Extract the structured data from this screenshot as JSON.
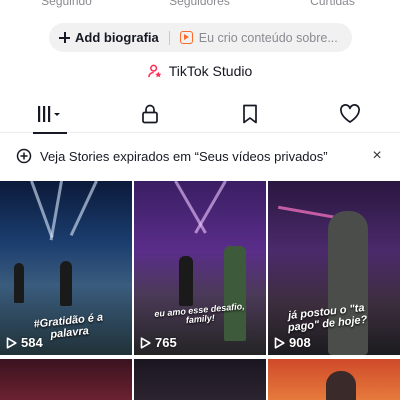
{
  "profile": {
    "stats": [
      "Seguindo",
      "Seguidores",
      "Curtidas"
    ]
  },
  "actions": {
    "add_bio_label": "Add biografia",
    "promo_text": "Eu crio conteúdo sobre..."
  },
  "studio": {
    "label": "TikTok Studio"
  },
  "tabs": [
    {
      "name": "videos",
      "icon": "grid-icon",
      "active": true
    },
    {
      "name": "private",
      "icon": "lock-icon",
      "active": false
    },
    {
      "name": "saved",
      "icon": "bookmark-icon",
      "active": false
    },
    {
      "name": "liked",
      "icon": "heart-icon",
      "active": false
    }
  ],
  "banner": {
    "text": "Veja Stories expirados em “Seus vídeos privados”",
    "close_label": "×"
  },
  "videos": [
    {
      "views": "584",
      "overlay": "#Gratidão é a palavra"
    },
    {
      "views": "765",
      "overlay": "eu amo esse desafio, family!"
    },
    {
      "views": "908",
      "overlay": "já postou o \"ta pago\" de hoje?"
    },
    {
      "views": "",
      "overlay": ""
    },
    {
      "views": "",
      "overlay": ""
    },
    {
      "views": "",
      "overlay": ""
    }
  ],
  "colors": {
    "text_primary": "#161823",
    "text_secondary": "#8a8b91",
    "pill_bg": "#f1f1f2",
    "studio_accent": "#fe2c55",
    "promo_icon": "#fe6a2c"
  }
}
